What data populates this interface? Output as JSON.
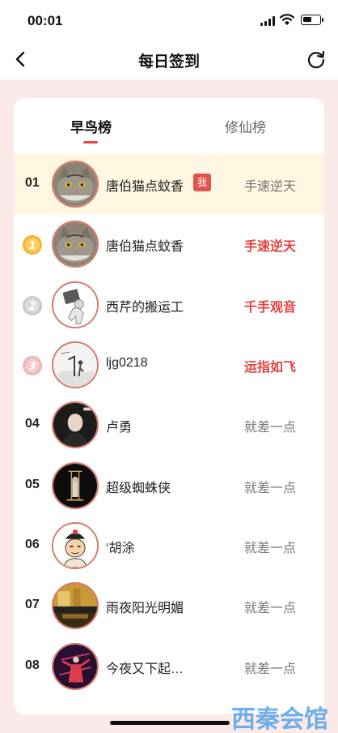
{
  "status": {
    "time": "00:01"
  },
  "header": {
    "title": "每日签到",
    "back_icon": "chevron-left-icon",
    "refresh_icon": "refresh-icon"
  },
  "tabs": [
    {
      "label": "早鸟榜",
      "active": true
    },
    {
      "label": "修仙榜",
      "active": false
    }
  ],
  "accent_color": "#e94c48",
  "rows": [
    {
      "rank": "01",
      "name": "唐伯猫点蚊香",
      "me_badge": "我",
      "title": "手速逆天",
      "highlight": true,
      "avatar": "cat-avatar"
    },
    {
      "rank": "1",
      "name": "唐伯猫点蚊香",
      "title": "手速逆天",
      "medal": "gold",
      "avatar": "cat-avatar"
    },
    {
      "rank": "2",
      "name": "西芹的搬运工",
      "title": "千手观音",
      "medal": "silver",
      "avatar": "porter-avatar"
    },
    {
      "rank": "3",
      "name": "ljg0218",
      "title": "运指如飞",
      "medal": "bronze",
      "avatar": "sketch-avatar"
    },
    {
      "rank": "04",
      "name": "卢勇",
      "title": "就差一点",
      "avatar": "portrait-avatar"
    },
    {
      "rank": "05",
      "name": "超级蜘蛛侠",
      "title": "就差一点",
      "avatar": "statue-avatar"
    },
    {
      "rank": "06",
      "name": "‘胡涂",
      "title": "就差一点",
      "avatar": "cartoon-avatar"
    },
    {
      "rank": "07",
      "name": "雨夜阳光明媚",
      "title": "就差一点",
      "avatar": "gold-avatar"
    },
    {
      "rank": "08",
      "name": "今夜又下起…",
      "title": "就差一点",
      "avatar": "dancer-avatar"
    }
  ],
  "watermark": "西秦会馆"
}
